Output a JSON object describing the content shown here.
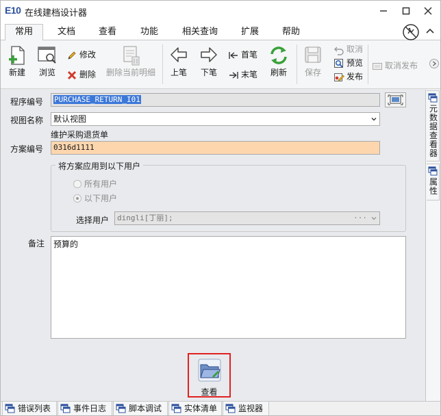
{
  "window": {
    "logo": "E10",
    "title": "在线建档设计器"
  },
  "tabs": [
    "常用",
    "文档",
    "查看",
    "功能",
    "相关查询",
    "扩展",
    "帮助"
  ],
  "ribbon": {
    "new": "新建",
    "browse": "浏览",
    "edit": "修改",
    "delete": "删除",
    "delete_detail": "删除当前明细",
    "prev": "上笔",
    "next": "下笔",
    "first": "首笔",
    "last": "末笔",
    "refresh": "刷新",
    "save": "保存",
    "cancel": "取消",
    "preview": "预览",
    "publish": "发布",
    "cancel_publish": "取消发布"
  },
  "form": {
    "program_code_label": "程序编号",
    "program_code_value": "PURCHASE_RETURN_I01",
    "view_name_label": "视图名称",
    "view_name_value": "默认视图",
    "view_desc": "维护采购退货单",
    "scheme_code_label": "方案编号",
    "scheme_code_value": "0316d1111",
    "apply_group_title": "将方案应用到以下用户",
    "all_users": "所有用户",
    "following_users": "以下用户",
    "select_user_label": "选择用户",
    "select_user_value": "dingli[丁丽];",
    "select_user_more": "···",
    "remark_label": "备注",
    "remark_value": "预算的"
  },
  "view_button": "查看",
  "right_rail": [
    "元数据查看器",
    "属性"
  ],
  "bottom_tabs": [
    "错误列表",
    "事件日志",
    "脚本调试",
    "实体清单",
    "监视器"
  ]
}
